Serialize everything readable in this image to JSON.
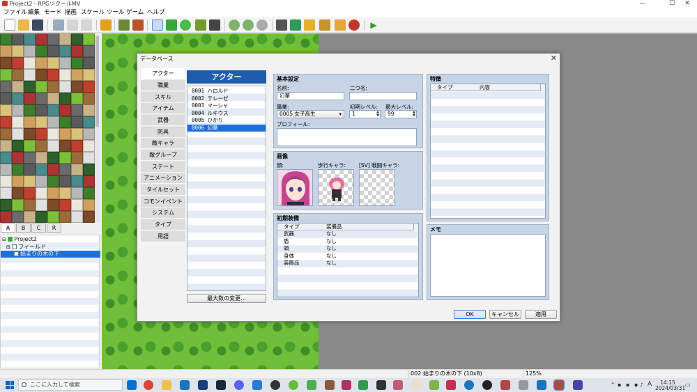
{
  "window": {
    "title": "Project2 - RPGツクールMV",
    "controls": [
      "—",
      "☐",
      "✕"
    ]
  },
  "menu": [
    "ファイル",
    "編集",
    "モード",
    "描画",
    "スケール",
    "ツール",
    "ゲーム",
    "ヘルプ"
  ],
  "toolbar_icons": [
    "new-icon",
    "open-icon",
    "save-icon",
    "cut-icon",
    "copy-icon",
    "paste-icon",
    "undo-icon",
    "map-mode-icon",
    "event-mode-icon",
    "pencil-icon",
    "rectangle-icon",
    "ellipse-icon",
    "fill-icon",
    "shadow-pen-icon",
    "zoom-in-icon",
    "zoom-out-icon",
    "actual-size-icon",
    "database-icon",
    "plugin-icon",
    "sound-test-icon",
    "event-search-icon",
    "resource-manager-icon",
    "character-generator-icon",
    "playtest-icon"
  ],
  "tile_tabs": [
    "A",
    "B",
    "C",
    "R"
  ],
  "map_tree": [
    {
      "label": "Project2",
      "level": 0,
      "icon": "project-icon"
    },
    {
      "label": "フィールド",
      "level": 1,
      "icon": "map-icon"
    },
    {
      "label": "始まりの木の下",
      "level": 2,
      "icon": "map-icon",
      "selected": true
    }
  ],
  "status": {
    "map": "002:始まりの木の下 (10x8)",
    "zoom": "125%"
  },
  "taskbar": {
    "search_placeholder": "ここに入力して検索",
    "time": "14:15",
    "date": "2024/03/31",
    "ime": "A"
  },
  "dialog": {
    "title": "データベース",
    "close": "✕",
    "categories": [
      "アクター",
      "職業",
      "スキル",
      "アイテム",
      "武器",
      "防具",
      "敵キャラ",
      "敵グループ",
      "ステート",
      "アニメーション",
      "タイルセット",
      "コモンイベント",
      "システム",
      "タイプ",
      "用語"
    ],
    "actor_header": "アクター",
    "actors": [
      "0001 ハロルド",
      "0002 テレーゼ",
      "0003 マーシャ",
      "0004 ルキウス",
      "0005 ひかり",
      "0006 幻華"
    ],
    "max_button": "最大数の変更...",
    "basic": {
      "title": "基本設定",
      "name_label": "名前:",
      "name": "幻華",
      "nickname_label": "二つ名:",
      "nickname": "",
      "class_label": "職業:",
      "class": "0005 女子高生",
      "initial_level_label": "初期レベル:",
      "initial_level": "1",
      "max_level_label": "最大レベル:",
      "max_level": "99",
      "profile_label": "プロフィール:",
      "profile": ""
    },
    "images": {
      "title": "画像",
      "face_label": "顔:",
      "walk_label": "歩行キャラ:",
      "battler_label": "[SV] 戦闘キャラ:"
    },
    "equipment": {
      "title": "初期装備",
      "columns": [
        "タイプ",
        "装備品"
      ],
      "rows": [
        [
          "武器",
          "なし"
        ],
        [
          "盾",
          "なし"
        ],
        [
          "頭",
          "なし"
        ],
        [
          "身体",
          "なし"
        ],
        [
          "装飾品",
          "なし"
        ]
      ]
    },
    "traits": {
      "title": "特徴",
      "columns": [
        "タイプ",
        "内容"
      ]
    },
    "memo": {
      "title": "メモ",
      "text": ""
    },
    "buttons": {
      "ok": "OK",
      "cancel": "キャンセル",
      "apply": "適用"
    }
  }
}
